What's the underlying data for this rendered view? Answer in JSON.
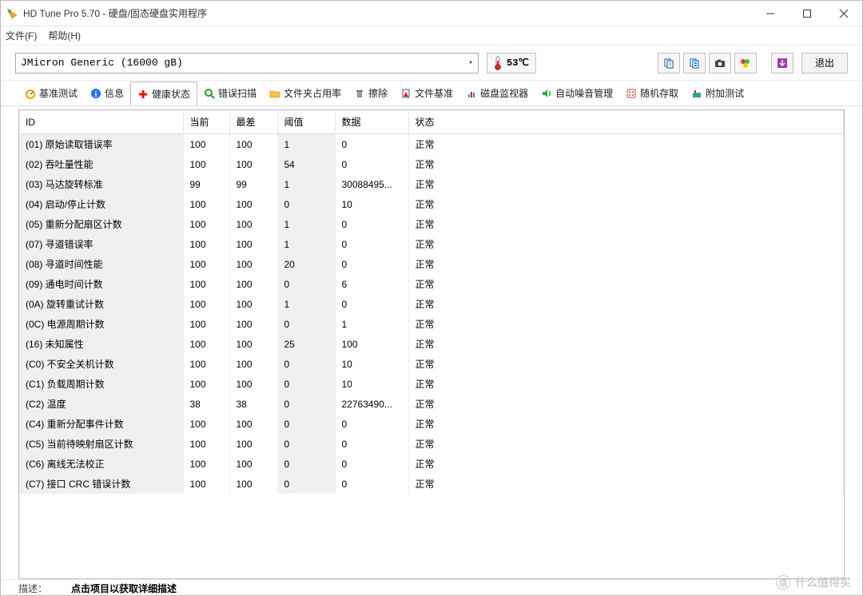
{
  "window": {
    "title": "HD Tune Pro 5.70 - 硬盘/固态硬盘实用程序"
  },
  "menu": {
    "file": "文件(F)",
    "help": "帮助(H)"
  },
  "toolbar": {
    "drive": "JMicron Generic (16000 gB)",
    "temp": "53℃",
    "exit": "退出"
  },
  "tabs": {
    "benchmark": "基准测试",
    "info": "信息",
    "health": "健康状态",
    "error_scan": "错误扫描",
    "folder_usage": "文件夹占用率",
    "erase": "擦除",
    "file_benchmark": "文件基准",
    "disk_monitor": "磁盘监视器",
    "aam": "自动噪音管理",
    "random_access": "随机存取",
    "extra_tests": "附加测试"
  },
  "columns": {
    "id": "ID",
    "current": "当前",
    "worst": "最差",
    "threshold": "阈值",
    "data": "数据",
    "status": "状态"
  },
  "rows": [
    {
      "id": "(01) 原始读取错误率",
      "cur": "100",
      "worst": "100",
      "th": "1",
      "data": "0",
      "status": "正常"
    },
    {
      "id": "(02) 吞吐量性能",
      "cur": "100",
      "worst": "100",
      "th": "54",
      "data": "0",
      "status": "正常"
    },
    {
      "id": "(03) 马达旋转标准",
      "cur": "99",
      "worst": "99",
      "th": "1",
      "data": "30088495...",
      "status": "正常"
    },
    {
      "id": "(04) 启动/停止计数",
      "cur": "100",
      "worst": "100",
      "th": "0",
      "data": "10",
      "status": "正常"
    },
    {
      "id": "(05) 重新分配扇区计数",
      "cur": "100",
      "worst": "100",
      "th": "1",
      "data": "0",
      "status": "正常"
    },
    {
      "id": "(07) 寻道错误率",
      "cur": "100",
      "worst": "100",
      "th": "1",
      "data": "0",
      "status": "正常"
    },
    {
      "id": "(08) 寻道时间性能",
      "cur": "100",
      "worst": "100",
      "th": "20",
      "data": "0",
      "status": "正常"
    },
    {
      "id": "(09) 通电时间计数",
      "cur": "100",
      "worst": "100",
      "th": "0",
      "data": "6",
      "status": "正常"
    },
    {
      "id": "(0A) 旋转重试计数",
      "cur": "100",
      "worst": "100",
      "th": "1",
      "data": "0",
      "status": "正常"
    },
    {
      "id": "(0C) 电源周期计数",
      "cur": "100",
      "worst": "100",
      "th": "0",
      "data": "1",
      "status": "正常"
    },
    {
      "id": "(16) 未知属性",
      "cur": "100",
      "worst": "100",
      "th": "25",
      "data": "100",
      "status": "正常"
    },
    {
      "id": "(C0) 不安全关机计数",
      "cur": "100",
      "worst": "100",
      "th": "0",
      "data": "10",
      "status": "正常"
    },
    {
      "id": "(C1) 负载周期计数",
      "cur": "100",
      "worst": "100",
      "th": "0",
      "data": "10",
      "status": "正常"
    },
    {
      "id": "(C2) 温度",
      "cur": "38",
      "worst": "38",
      "th": "0",
      "data": "22763490...",
      "status": "正常"
    },
    {
      "id": "(C4) 重新分配事件计数",
      "cur": "100",
      "worst": "100",
      "th": "0",
      "data": "0",
      "status": "正常"
    },
    {
      "id": "(C5) 当前待映射扇区计数",
      "cur": "100",
      "worst": "100",
      "th": "0",
      "data": "0",
      "status": "正常"
    },
    {
      "id": "(C6) 离线无法校正",
      "cur": "100",
      "worst": "100",
      "th": "0",
      "data": "0",
      "status": "正常"
    },
    {
      "id": "(C7) 接口 CRC 错误计数",
      "cur": "100",
      "worst": "100",
      "th": "0",
      "data": "0",
      "status": "正常"
    }
  ],
  "desc": {
    "label": "描述：",
    "text": "点击项目以获取详细描述"
  },
  "watermark": "什么值得买"
}
